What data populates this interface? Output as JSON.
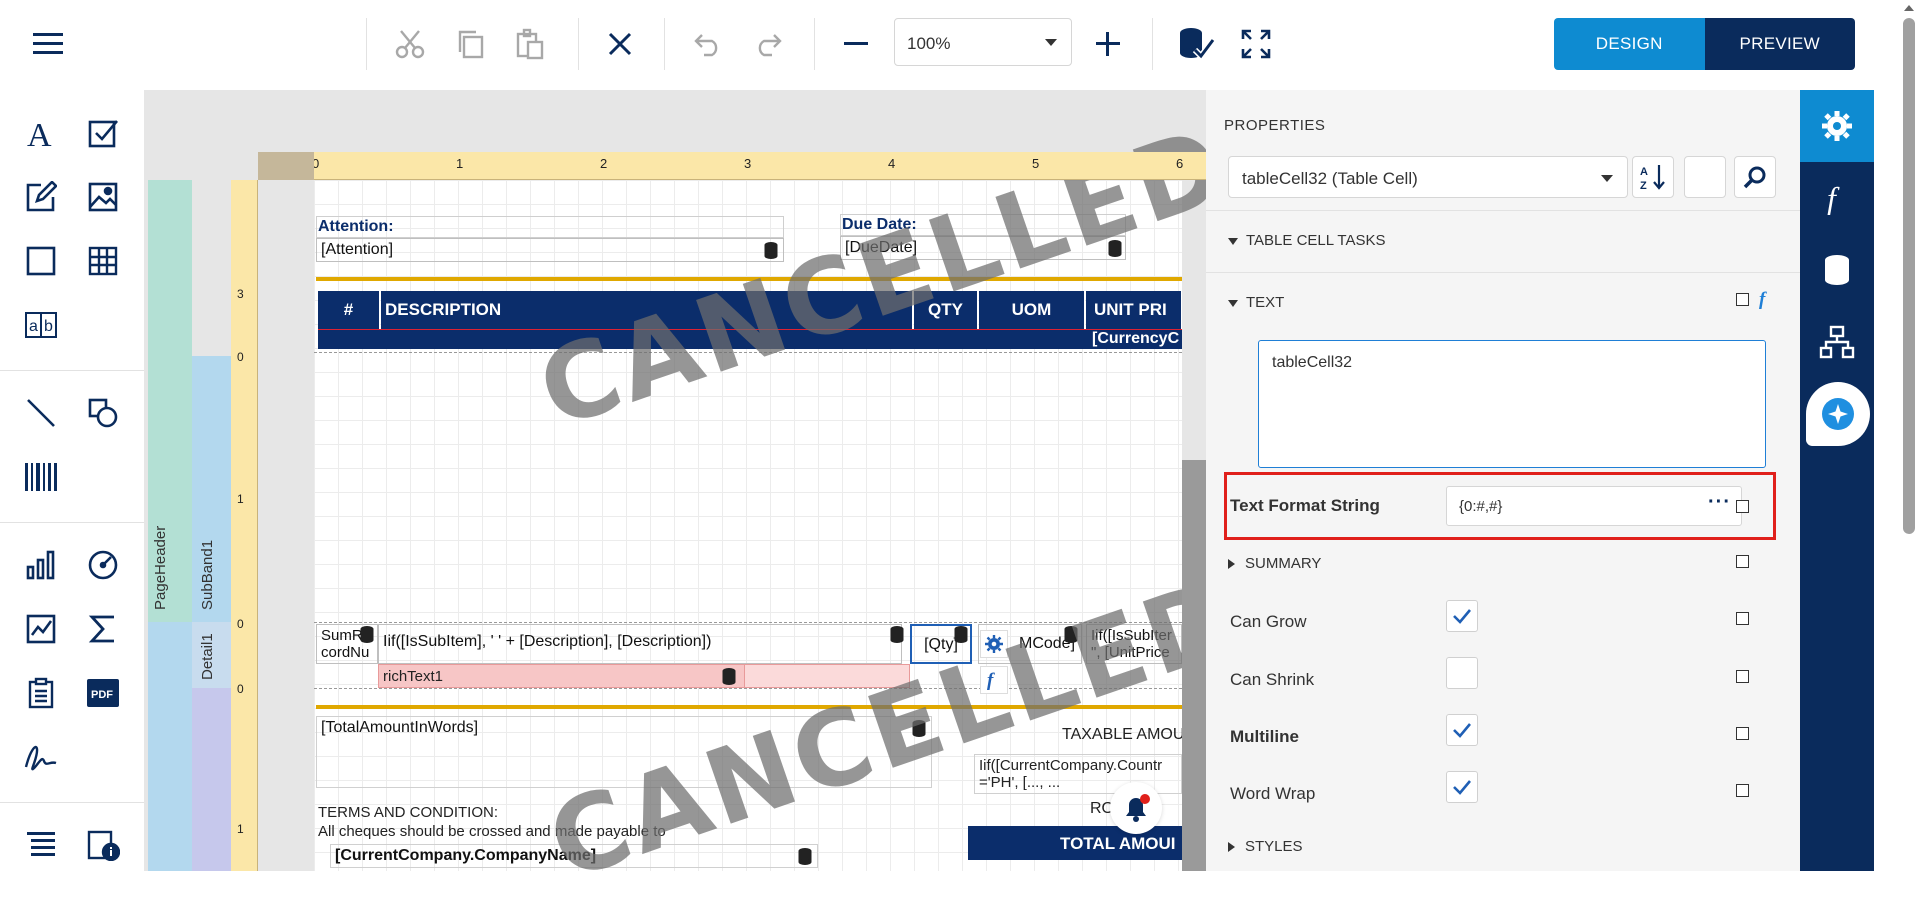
{
  "toolbar": {
    "zoom_value": "100%",
    "design_label": "DESIGN",
    "preview_label": "PREVIEW"
  },
  "canvas": {
    "ruler_top": [
      "0",
      "1",
      "2",
      "3",
      "4",
      "5",
      "6"
    ],
    "ruler_left": [
      "3",
      "0",
      "1",
      "0",
      "0",
      "1"
    ],
    "bands": {
      "page_header": "PageHeader",
      "sub_band": "SubBand1",
      "detail": "Detail1"
    },
    "attention_label": "Attention:",
    "attention_value": "[Attention]",
    "due_date_label": "Due Date:",
    "due_date_value": "[DueDate]",
    "table_headers": [
      "#",
      "DESCRIPTION",
      "QTY",
      "UOM",
      "UNIT PRI"
    ],
    "currency_cell": "[CurrencyC",
    "watermark": "CANCELLED",
    "row_sum": "SumR cordNu",
    "row_desc": "Iif([IsSubItem], '   ' + [Description], [Description])",
    "row_qty": "[Qty]",
    "row_uom": "MCode]",
    "row_unit": "Iif([IsSubIter \", [UnitPrice",
    "rich_text": "richText1",
    "total_words": "[TotalAmountInWords]",
    "taxable": "TAXABLE AMOU",
    "country_expr": "Iif([CurrentCompany.Countr ='PH', [..., ...",
    "ro_label": "RO",
    "total_amount": "TOTAL AMOUI",
    "terms_title": "TERMS AND CONDITION:",
    "terms_text": "All cheques should be crossed and made payable to",
    "company_name": "[CurrentCompany.CompanyName]"
  },
  "properties": {
    "title": "PROPERTIES",
    "selected_component": "tableCell32 (Table Cell)",
    "section_tasks": "TABLE CELL TASKS",
    "section_text": "TEXT",
    "text_value": "tableCell32",
    "format_label": "Text Format String",
    "format_value": "{0:#,#}",
    "section_summary": "SUMMARY",
    "can_grow_label": "Can Grow",
    "can_grow": true,
    "can_shrink_label": "Can Shrink",
    "can_shrink": false,
    "multiline_label": "Multiline",
    "multiline": true,
    "word_wrap_label": "Word Wrap",
    "word_wrap": true,
    "section_styles": "STYLES"
  },
  "colors": {
    "accent_blue": "#0e8bd1",
    "navy": "#0a2b5c",
    "highlight_red": "#e0201b",
    "ruler_yellow": "#fbe7a8"
  },
  "icons": [
    "menu-icon",
    "cut-icon",
    "copy-icon",
    "paste-icon",
    "delete-icon",
    "undo-icon",
    "redo-icon",
    "zoom-out-icon",
    "zoom-in-icon",
    "validate-icon",
    "fullscreen-icon",
    "settings-icon",
    "function-icon",
    "database-icon",
    "hierarchy-icon",
    "ai-chat-icon",
    "bell-icon"
  ]
}
